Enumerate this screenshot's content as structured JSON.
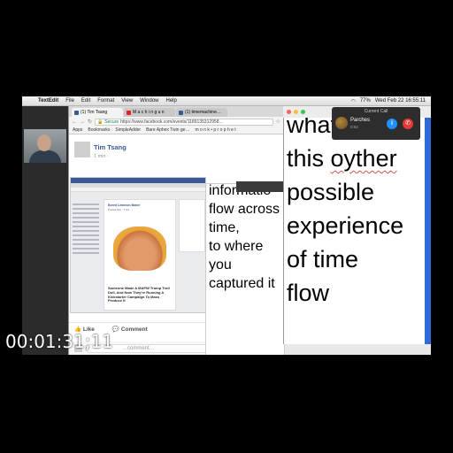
{
  "menubar": {
    "app_name": "TextEdit",
    "items": [
      "File",
      "Edit",
      "Format",
      "View",
      "Window",
      "Help"
    ],
    "clock": "Wed Feb 22  16:55:11",
    "battery": "77%"
  },
  "browser": {
    "tabs": [
      {
        "label": "(1) Tim Tsang",
        "icon": "facebook-icon"
      },
      {
        "label": "M a c h i n g u n",
        "icon": "youtube-icon"
      },
      {
        "label": "(1) timemachine…",
        "icon": "facebook-icon"
      }
    ],
    "secure_label": "Secure",
    "url": "https://www.facebook.com/events/1189135312958…",
    "bookmarks": [
      "Apps",
      "Bookmarks",
      "SimpleAdder",
      "Bare Aphex Twin ge…",
      "m o n k • p r o p h e t"
    ]
  },
  "post": {
    "author": "Tim Tsang",
    "time": "1 min ·",
    "headline": "Someone Made A MAPW Trump Troll Doll, And Now They're Running A Kickstarter Campaign To Mass Produce It",
    "card_title": "Bored Lemmon Baker",
    "card_sub": "Posted this · 7 hrs",
    "like_label": "Like",
    "comment_label": "Comment",
    "comment_placeholder": "…comment…"
  },
  "textedit_left": {
    "text": "informatio\nflow across\ntime,\nto where\nyou\ncaptured it"
  },
  "textedit_right": {
    "line1": "whatever",
    "line2_a": "this ",
    "line2_b": "oyther",
    "line3": "possible",
    "line4": "experience",
    "line5": "of time",
    "line6": "flow"
  },
  "call": {
    "title": "Current Call",
    "name": "Parches",
    "sub": "0:02"
  },
  "timecode": "00:01:31;11"
}
